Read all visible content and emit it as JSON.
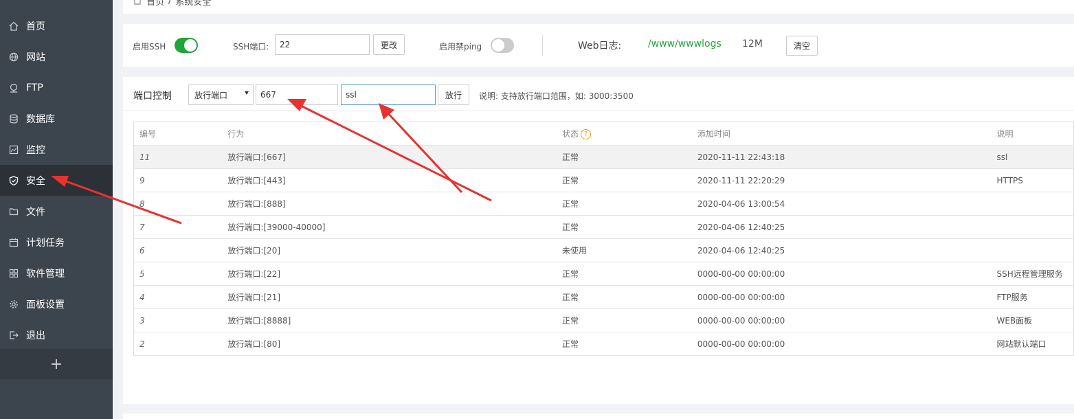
{
  "sidebar": {
    "items": [
      {
        "label": "首页",
        "icon": "home-icon"
      },
      {
        "label": "网站",
        "icon": "globe-icon"
      },
      {
        "label": "FTP",
        "icon": "ftp-icon"
      },
      {
        "label": "数据库",
        "icon": "database-icon"
      },
      {
        "label": "监控",
        "icon": "monitor-icon"
      },
      {
        "label": "安全",
        "icon": "shield-icon",
        "active": true
      },
      {
        "label": "文件",
        "icon": "folder-icon"
      },
      {
        "label": "计划任务",
        "icon": "calendar-icon"
      },
      {
        "label": "软件管理",
        "icon": "apps-icon"
      },
      {
        "label": "面板设置",
        "icon": "gear-icon"
      },
      {
        "label": "退出",
        "icon": "logout-icon"
      }
    ],
    "add_label": "+"
  },
  "breadcrumb": {
    "home": "首页",
    "separator": "/",
    "current": "系统安全"
  },
  "settings": {
    "ssh_label": "启用SSH",
    "ssh_enabled": true,
    "ssh_port_label": "SSH端口:",
    "ssh_port_value": "22",
    "change_button": "更改",
    "ping_label": "启用禁ping",
    "ping_enabled": false,
    "weblog_label": "Web日志:",
    "weblog_path": "/www/wwwlogs",
    "weblog_size": "12M",
    "clear_button": "清空"
  },
  "port_control": {
    "title": "端口控制",
    "select_value": "放行端口",
    "port_value": "667",
    "note_value": "ssl",
    "allow_button": "放行",
    "hint": "说明: 支持放行端口范围，如: 3000:3500"
  },
  "table": {
    "headers": [
      "编号",
      "行为",
      "状态",
      "添加时间",
      "说明"
    ],
    "help_icon": "?",
    "rows": [
      {
        "id": "11",
        "action": "放行端口:[667]",
        "status": "正常",
        "time": "2020-11-11 22:43:18",
        "note": "ssl"
      },
      {
        "id": "9",
        "action": "放行端口:[443]",
        "status": "正常",
        "time": "2020-11-11 22:20:29",
        "note": "HTTPS"
      },
      {
        "id": "8",
        "action": "放行端口:[888]",
        "status": "正常",
        "time": "2020-04-06 13:00:54",
        "note": ""
      },
      {
        "id": "7",
        "action": "放行端口:[39000-40000]",
        "status": "正常",
        "time": "2020-04-06 12:40:25",
        "note": ""
      },
      {
        "id": "6",
        "action": "放行端口:[20]",
        "status": "未使用",
        "time": "2020-04-06 12:40:25",
        "note": ""
      },
      {
        "id": "5",
        "action": "放行端口:[22]",
        "status": "正常",
        "time": "0000-00-00 00:00:00",
        "note": "SSH远程管理服务"
      },
      {
        "id": "4",
        "action": "放行端口:[21]",
        "status": "正常",
        "time": "0000-00-00 00:00:00",
        "note": "FTP服务"
      },
      {
        "id": "3",
        "action": "放行端口:[8888]",
        "status": "正常",
        "time": "0000-00-00 00:00:00",
        "note": "WEB面板"
      },
      {
        "id": "2",
        "action": "放行端口:[80]",
        "status": "正常",
        "time": "0000-00-00 00:00:00",
        "note": "网站默认端口"
      }
    ]
  },
  "colors": {
    "sidebar_bg": "#3c444d",
    "sidebar_active": "#2c3138",
    "accent_green": "#20a53a",
    "arrow_red": "#e8322f",
    "focus_blue": "#5b9bd5"
  }
}
